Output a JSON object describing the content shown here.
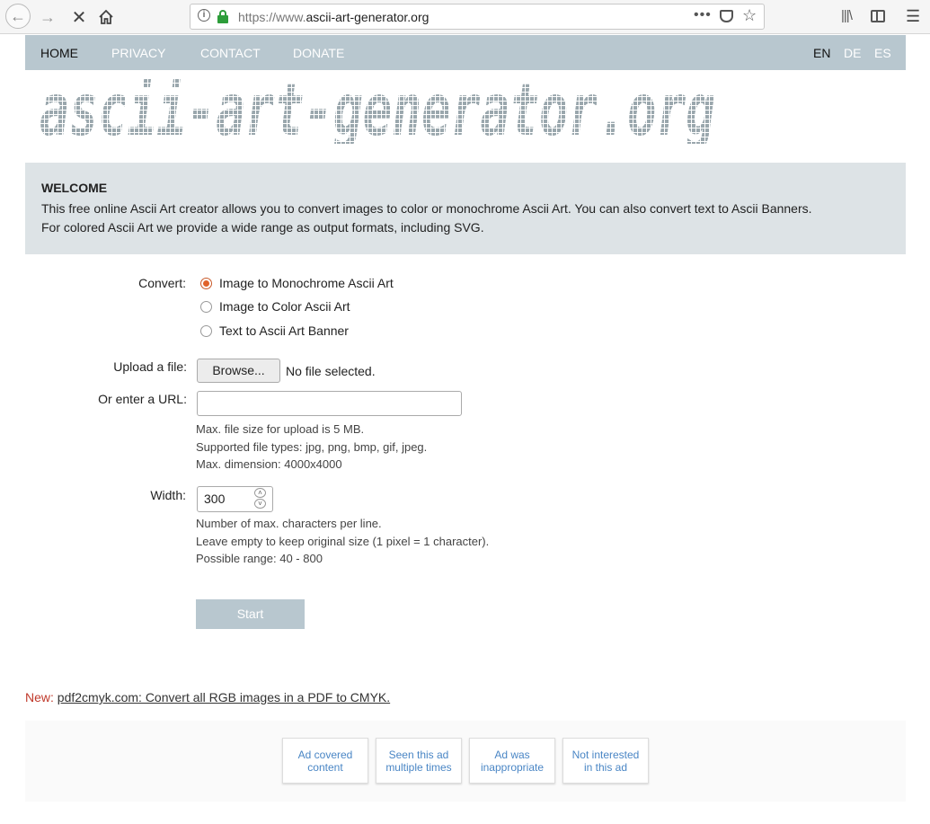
{
  "browser": {
    "url_prefix": "https://www.",
    "url_host": "ascii-art-generator.org",
    "url_dots": "•••"
  },
  "nav": {
    "items": [
      "HOME",
      "PRIVACY",
      "CONTACT",
      "DONATE"
    ],
    "languages": [
      "EN",
      "DE",
      "ES"
    ]
  },
  "logo": {
    "text": "ascii-art-generator.org"
  },
  "welcome": {
    "title": "WELCOME",
    "line1": "This free online Ascii Art creator allows you to convert images to color or monochrome Ascii Art. You can also convert text to Ascii Banners.",
    "line2": "For colored Ascii Art we provide a wide range as output formats, including SVG."
  },
  "form": {
    "convert_label": "Convert:",
    "options": [
      "Image to Monochrome Ascii Art",
      "Image to Color Ascii Art",
      "Text to Ascii Art Banner"
    ],
    "upload_label": "Upload a file:",
    "browse_label": "Browse...",
    "no_file": "No file selected.",
    "url_label": "Or enter a URL:",
    "url_value": "",
    "help1": [
      "Max. file size for upload is 5 MB.",
      "Supported file types: jpg, png, bmp, gif, jpeg.",
      "Max. dimension: 4000x4000"
    ],
    "width_label": "Width:",
    "width_value": "300",
    "help2": [
      "Number of max. characters per line.",
      "Leave empty to keep original size (1 pixel = 1 character).",
      "Possible range: 40 - 800"
    ],
    "start_label": "Start"
  },
  "footer": {
    "new_label": "New:",
    "link_text": "pdf2cmyk.com: Convert all RGB images in a PDF to CMYK."
  },
  "ads": {
    "buttons": [
      [
        "Ad covered",
        "content"
      ],
      [
        "Seen this ad",
        "multiple times"
      ],
      [
        "Ad was",
        "inappropriate"
      ],
      [
        "Not interested",
        "in this ad"
      ]
    ]
  }
}
